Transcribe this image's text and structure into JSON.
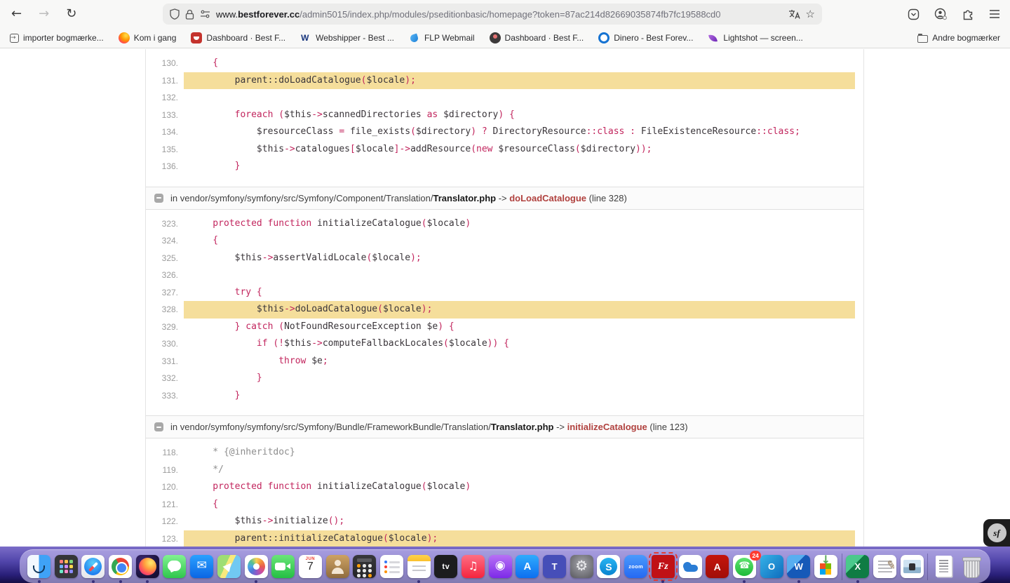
{
  "colors": {
    "accent_keyword": "#C2265E",
    "code_text": "#3A353A",
    "comment": "#8E8E8E",
    "line_highlight": "#F5DE9B",
    "trace_function": "#B0413E"
  },
  "browser": {
    "url": {
      "www": "www.",
      "domain": "bestforever.cc",
      "path": "/admin5015/index.php/modules/pseditionbasic/homepage?token=87ac214d82669035874fb7fc19588cd0"
    },
    "toolbar_icons": [
      "back",
      "forward",
      "reload",
      "shield",
      "lock",
      "permissions",
      "translate",
      "bookmark-star",
      "pocket",
      "account",
      "extensions",
      "menu"
    ]
  },
  "bookmarks_bar": {
    "items": [
      {
        "label": "importer bogmærke...",
        "icon": "import"
      },
      {
        "label": "Kom i gang",
        "icon": "firefox"
      },
      {
        "label": "Dashboard · Best F...",
        "icon": "dashboard-red"
      },
      {
        "label": "Webshipper - Best ...",
        "icon": "webshipper"
      },
      {
        "label": "FLP Webmail",
        "icon": "webmail"
      },
      {
        "label": "Dashboard · Best F...",
        "icon": "dashboard-dark"
      },
      {
        "label": "Dinero - Best Forev...",
        "icon": "dinero"
      },
      {
        "label": "Lightshot — screen...",
        "icon": "lightshot"
      }
    ],
    "other_bookmarks_label": "Andre bogmærker"
  },
  "trace": {
    "blocks": [
      {
        "type": "code",
        "lines": [
          {
            "no": "130.",
            "segs": [
              [
                "k",
                "    {"
              ]
            ]
          },
          {
            "no": "131.",
            "hl": true,
            "segs": [
              [
                "d",
                "        parent::doLoadCatalogue"
              ],
              [
                "k",
                "("
              ],
              [
                "d",
                "$locale"
              ],
              [
                "k",
                ");"
              ]
            ]
          },
          {
            "no": "132.",
            "segs": []
          },
          {
            "no": "133.",
            "segs": [
              [
                "k",
                "        foreach ("
              ],
              [
                "d",
                "$this"
              ],
              [
                "k",
                "->"
              ],
              [
                "d",
                "scannedDirectories"
              ],
              [
                "k",
                " as "
              ],
              [
                "d",
                "$directory"
              ],
              [
                "k",
                ") {"
              ]
            ]
          },
          {
            "no": "134.",
            "segs": [
              [
                "d",
                "            $resourceClass "
              ],
              [
                "k",
                "= "
              ],
              [
                "d",
                "file_exists"
              ],
              [
                "k",
                "("
              ],
              [
                "d",
                "$directory"
              ],
              [
                "k",
                ") ? "
              ],
              [
                "d",
                "DirectoryResource"
              ],
              [
                "k",
                "::class"
              ],
              [
                "k",
                " : "
              ],
              [
                "d",
                "FileExistenceResource"
              ],
              [
                "k",
                "::class;"
              ]
            ]
          },
          {
            "no": "135.",
            "segs": [
              [
                "d",
                "            $this"
              ],
              [
                "k",
                "->"
              ],
              [
                "d",
                "catalogues"
              ],
              [
                "k",
                "["
              ],
              [
                "d",
                "$locale"
              ],
              [
                "k",
                "]->"
              ],
              [
                "d",
                "addResource"
              ],
              [
                "k",
                "(new "
              ],
              [
                "d",
                "$resourceClass"
              ],
              [
                "k",
                "("
              ],
              [
                "d",
                "$directory"
              ],
              [
                "k",
                "));"
              ]
            ]
          },
          {
            "no": "136.",
            "segs": [
              [
                "k",
                "        }"
              ]
            ]
          }
        ]
      },
      {
        "type": "header",
        "prefix": "in vendor/symfony/symfony/src/Symfony/Component/Translation/",
        "file": "Translator.php",
        "arrow": "->",
        "func": "doLoadCatalogue",
        "line_info": "(line 328)"
      },
      {
        "type": "code",
        "lines": [
          {
            "no": "323.",
            "segs": [
              [
                "k",
                "    protected function "
              ],
              [
                "d",
                "initializeCatalogue"
              ],
              [
                "k",
                "("
              ],
              [
                "d",
                "$locale"
              ],
              [
                "k",
                ")"
              ]
            ]
          },
          {
            "no": "324.",
            "segs": [
              [
                "k",
                "    {"
              ]
            ]
          },
          {
            "no": "325.",
            "segs": [
              [
                "d",
                "        $this"
              ],
              [
                "k",
                "->"
              ],
              [
                "d",
                "assertValidLocale"
              ],
              [
                "k",
                "("
              ],
              [
                "d",
                "$locale"
              ],
              [
                "k",
                ");"
              ]
            ]
          },
          {
            "no": "326.",
            "segs": []
          },
          {
            "no": "327.",
            "segs": [
              [
                "k",
                "        try {"
              ]
            ]
          },
          {
            "no": "328.",
            "hl": true,
            "segs": [
              [
                "d",
                "            $this"
              ],
              [
                "k",
                "->"
              ],
              [
                "d",
                "doLoadCatalogue"
              ],
              [
                "k",
                "("
              ],
              [
                "d",
                "$locale"
              ],
              [
                "k",
                ");"
              ]
            ]
          },
          {
            "no": "329.",
            "segs": [
              [
                "k",
                "        } catch ("
              ],
              [
                "d",
                "NotFoundResourceException $e"
              ],
              [
                "k",
                ") {"
              ]
            ]
          },
          {
            "no": "330.",
            "segs": [
              [
                "k",
                "            if (!"
              ],
              [
                "d",
                "$this"
              ],
              [
                "k",
                "->"
              ],
              [
                "d",
                "computeFallbackLocales"
              ],
              [
                "k",
                "("
              ],
              [
                "d",
                "$locale"
              ],
              [
                "k",
                ")) {"
              ]
            ]
          },
          {
            "no": "331.",
            "segs": [
              [
                "k",
                "                throw "
              ],
              [
                "d",
                "$e"
              ],
              [
                "k",
                ";"
              ]
            ]
          },
          {
            "no": "332.",
            "segs": [
              [
                "k",
                "            }"
              ]
            ]
          },
          {
            "no": "333.",
            "segs": [
              [
                "k",
                "        }"
              ]
            ]
          }
        ]
      },
      {
        "type": "header",
        "prefix": "in vendor/symfony/symfony/src/Symfony/Bundle/FrameworkBundle/Translation/",
        "file": "Translator.php",
        "arrow": "->",
        "func": "initializeCatalogue",
        "line_info": "(line 123)"
      },
      {
        "type": "code",
        "lines": [
          {
            "no": "118.",
            "segs": [
              [
                "c",
                "    * {@inheritdoc}"
              ]
            ]
          },
          {
            "no": "119.",
            "segs": [
              [
                "c",
                "    */"
              ]
            ]
          },
          {
            "no": "120.",
            "segs": [
              [
                "k",
                "    protected function "
              ],
              [
                "d",
                "initializeCatalogue"
              ],
              [
                "k",
                "("
              ],
              [
                "d",
                "$locale"
              ],
              [
                "k",
                ")"
              ]
            ]
          },
          {
            "no": "121.",
            "segs": [
              [
                "k",
                "    {"
              ]
            ]
          },
          {
            "no": "122.",
            "segs": [
              [
                "d",
                "        $this"
              ],
              [
                "k",
                "->"
              ],
              [
                "d",
                "initialize"
              ],
              [
                "k",
                "();"
              ]
            ]
          },
          {
            "no": "123.",
            "hl": true,
            "segs": [
              [
                "d",
                "        parent::initializeCatalogue"
              ],
              [
                "k",
                "("
              ],
              [
                "d",
                "$locale"
              ],
              [
                "k",
                ");"
              ]
            ]
          }
        ]
      }
    ]
  },
  "dock": {
    "items": [
      {
        "name": "finder",
        "dot": true
      },
      {
        "name": "launchpad"
      },
      {
        "name": "safari",
        "dot": true
      },
      {
        "name": "chrome",
        "dot": true
      },
      {
        "name": "firefox",
        "dot": true
      },
      {
        "name": "messages"
      },
      {
        "name": "mail"
      },
      {
        "name": "maps"
      },
      {
        "name": "photos",
        "dot": true
      },
      {
        "name": "facetime"
      },
      {
        "name": "calendar",
        "month": "JUN",
        "day": "7"
      },
      {
        "name": "contacts"
      },
      {
        "name": "calculator"
      },
      {
        "name": "reminders"
      },
      {
        "name": "notes",
        "dot": true
      },
      {
        "name": "apple-tv",
        "label": "tv"
      },
      {
        "name": "music"
      },
      {
        "name": "podcasts"
      },
      {
        "name": "app-store",
        "label": "A"
      },
      {
        "name": "teams",
        "label": "T"
      },
      {
        "name": "system-settings"
      },
      {
        "name": "skype",
        "label": "S"
      },
      {
        "name": "zoom",
        "label": "zoom"
      },
      {
        "name": "filezilla",
        "label": "Fz",
        "dot": true,
        "selected": true
      },
      {
        "name": "onedrive"
      },
      {
        "name": "acrobat",
        "label": "A"
      },
      {
        "name": "whatsapp",
        "badge": "24",
        "dot": true
      },
      {
        "name": "outlook",
        "label": "O"
      },
      {
        "name": "word",
        "label": "W",
        "dot": true
      },
      {
        "name": "ms-installer"
      },
      {
        "separator": true
      },
      {
        "name": "excel",
        "label": "X",
        "dot": true
      },
      {
        "name": "textedit"
      },
      {
        "name": "preview-image"
      },
      {
        "separator": true
      },
      {
        "name": "document-stack"
      },
      {
        "name": "trash"
      }
    ]
  },
  "symfony_badge": {
    "label": "sf"
  }
}
